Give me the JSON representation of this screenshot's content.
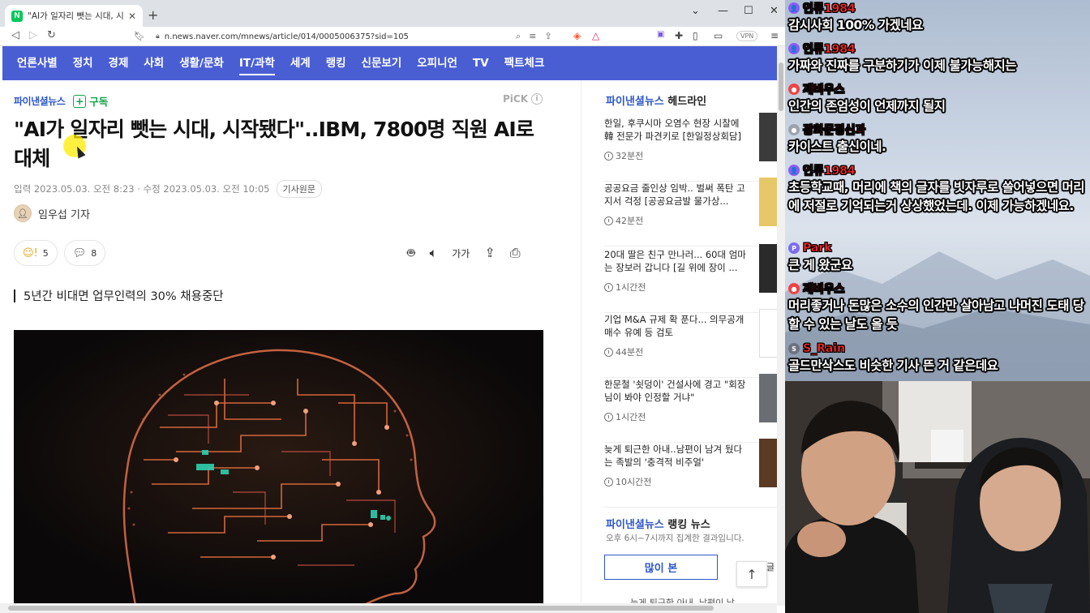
{
  "browser": {
    "tab_title": "\"AI가 일자리 뺏는 시대, 시작됐다\"..IBM, 7800명",
    "url": "n.news.naver.com/mnews/article/014/0005006375?sid=105",
    "vpn_label": "VPN",
    "window_controls": [
      "⌄",
      "—",
      "☐",
      "✕"
    ]
  },
  "nav": {
    "items": [
      "언론사별",
      "정치",
      "경제",
      "사회",
      "생활/문화",
      "IT/과학",
      "세계",
      "랭킹",
      "신문보기",
      "오피니언",
      "TV",
      "팩트체크"
    ],
    "active_index": 5,
    "color": "#4a5ed4"
  },
  "article": {
    "press_name": "파이낸셜뉴스",
    "subscribe_label": "구독",
    "pick_label": "PiCK",
    "headline": "\"AI가 일자리 뺏는 시대, 시작됐다\"..IBM, 7800명 직원 AI로 대체",
    "dateline": "입력 2023.05.03. 오전 8:23 · 수정 2023.05.03. 오전 10:05",
    "original_label": "기사원문",
    "reporter": "임우섭 기자",
    "reaction_count": "5",
    "comment_count": "8",
    "font_size_label": "가가",
    "subheading": "5년간 비대면 업무인력의 30% 채용중단"
  },
  "sidebar": {
    "headline_press": "파이낸셜뉴스",
    "headline_suffix": "헤드라인",
    "news": [
      {
        "text": "한일, 후쿠시마 오염수 현장 시찰에 韓 전문가 파견키로 [한일정상회담]",
        "time": "32분전"
      },
      {
        "text": "공공요금 줄인상 임박.. 벌써 폭탄 고지서 걱정 [공공요금발 물가상...",
        "time": "42분전"
      },
      {
        "text": "20대 딸은 친구 만나러... 60대 엄마는 장보러 갑니다 [길 위에 장이 ...",
        "time": "1시간전"
      },
      {
        "text": "기업 M&A 규제 확 푼다... 의무공개매수 유예 등 검토",
        "time": "44분전"
      },
      {
        "text": "한문철 '쇳덩이' 건설사에 경고 \"회장님이 봐야 인정할 거냐\"",
        "time": "1시간전"
      },
      {
        "text": "늦게 퇴근한 아내..남편이 남겨 뒀다는 족발의 '충격적 비주얼'",
        "time": "10시간전"
      }
    ],
    "ranking_press": "파이낸셜뉴스",
    "ranking_suffix": "랭킹 뉴스",
    "ranking_sub": "오후 6시~7시까지 집계한 결과입니다.",
    "most_viewed_label": "많이 본",
    "peek_text": "글",
    "bottom_peek": "늦게 퇴근한 아내..남편이 남"
  },
  "chat": {
    "messages": [
      {
        "user": "인류1984",
        "badge": "purple",
        "text": "감시사회 100% 가겠네요"
      },
      {
        "user": "인류1984",
        "badge": "purple",
        "text": "가짜와 진짜를 구분하기가 이제 불가능해지는"
      },
      {
        "user": "제비우스",
        "badge": "red",
        "text": "인간의 존엄성이 언제까지 될지"
      },
      {
        "user": "광화문정신과",
        "badge": "gray",
        "text": "카이스트 출신이네."
      },
      {
        "user": "인류1984",
        "badge": "purple",
        "text": "초등학교때, 머리에 책의 글자를 빗자루로 쓸어넣으면 머리에 저절로 기억되는거 상상했었는데. 이제 가능하겠네요."
      },
      {
        "user": "Park",
        "badge": "purple-p",
        "text": "큰 게 왔군요"
      },
      {
        "user": "제비우스",
        "badge": "red",
        "text": "머리좋거나 돈많은 소수의 인간만 살아남고 나머진 도태 당 할 수 있는 날도 올 듯"
      },
      {
        "user": "S_Rain",
        "badge": "gray-s",
        "text": "골드만삭스도 비슷한 기사 뜬 거 같은데요"
      }
    ]
  },
  "colors": {
    "brand_blue": "#2c57c6",
    "subscribe_green": "#16a34a",
    "chat_name": "#ff2727"
  }
}
